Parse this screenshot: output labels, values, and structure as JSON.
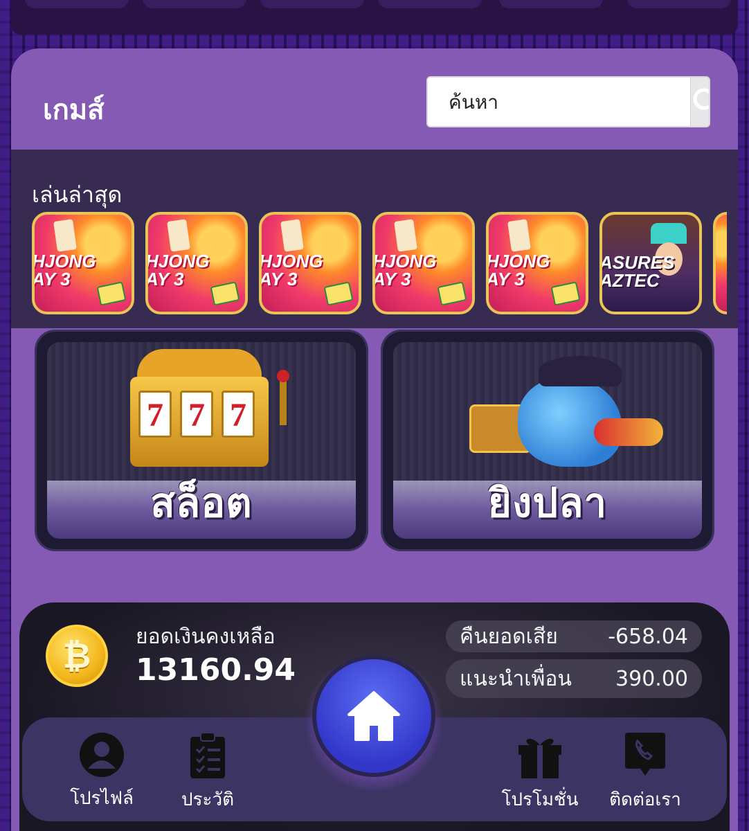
{
  "games_section": {
    "title": "เกมส์",
    "search": {
      "placeholder": "ค้นหา"
    },
    "recent": {
      "label": "เล่นล่าสุด",
      "tiles": [
        {
          "line1": "HJONG",
          "line2": "AY 3"
        },
        {
          "line1": "HJONG",
          "line2": "AY 3"
        },
        {
          "line1": "HJONG",
          "line2": "AY 3"
        },
        {
          "line1": "HJONG",
          "line2": "AY 3"
        },
        {
          "line1": "HJONG",
          "line2": "AY 3"
        },
        {
          "line1": "ASURES",
          "line2": "AZTEC"
        }
      ]
    },
    "categories": [
      {
        "label": "สล็อต",
        "icon": "slot-machine-icon"
      },
      {
        "label": "ยิงปลา",
        "icon": "fish-shooter-icon"
      }
    ],
    "slot_reels": [
      "7",
      "7",
      "7"
    ]
  },
  "balance": {
    "label": "ยอดเงินคงเหลือ",
    "value": "13160.94",
    "coin_symbol": "₿",
    "cashback": {
      "label": "คืนยอดเสีย",
      "value": "-658.04"
    },
    "referral": {
      "label": "แนะนำเพื่อน",
      "value": "390.00"
    }
  },
  "bottom_nav": {
    "profile": "โปรไฟล์",
    "history": "ประวัติ",
    "promotion": "โปรโมชั่น",
    "contact": "ติดต่อเรา"
  },
  "colors": {
    "card_bg": "#855ab4",
    "recent_bg": "#372b52",
    "tile_border": "#e9c558",
    "home_button": "#3337c9",
    "nav_bg": "#3c3463"
  }
}
